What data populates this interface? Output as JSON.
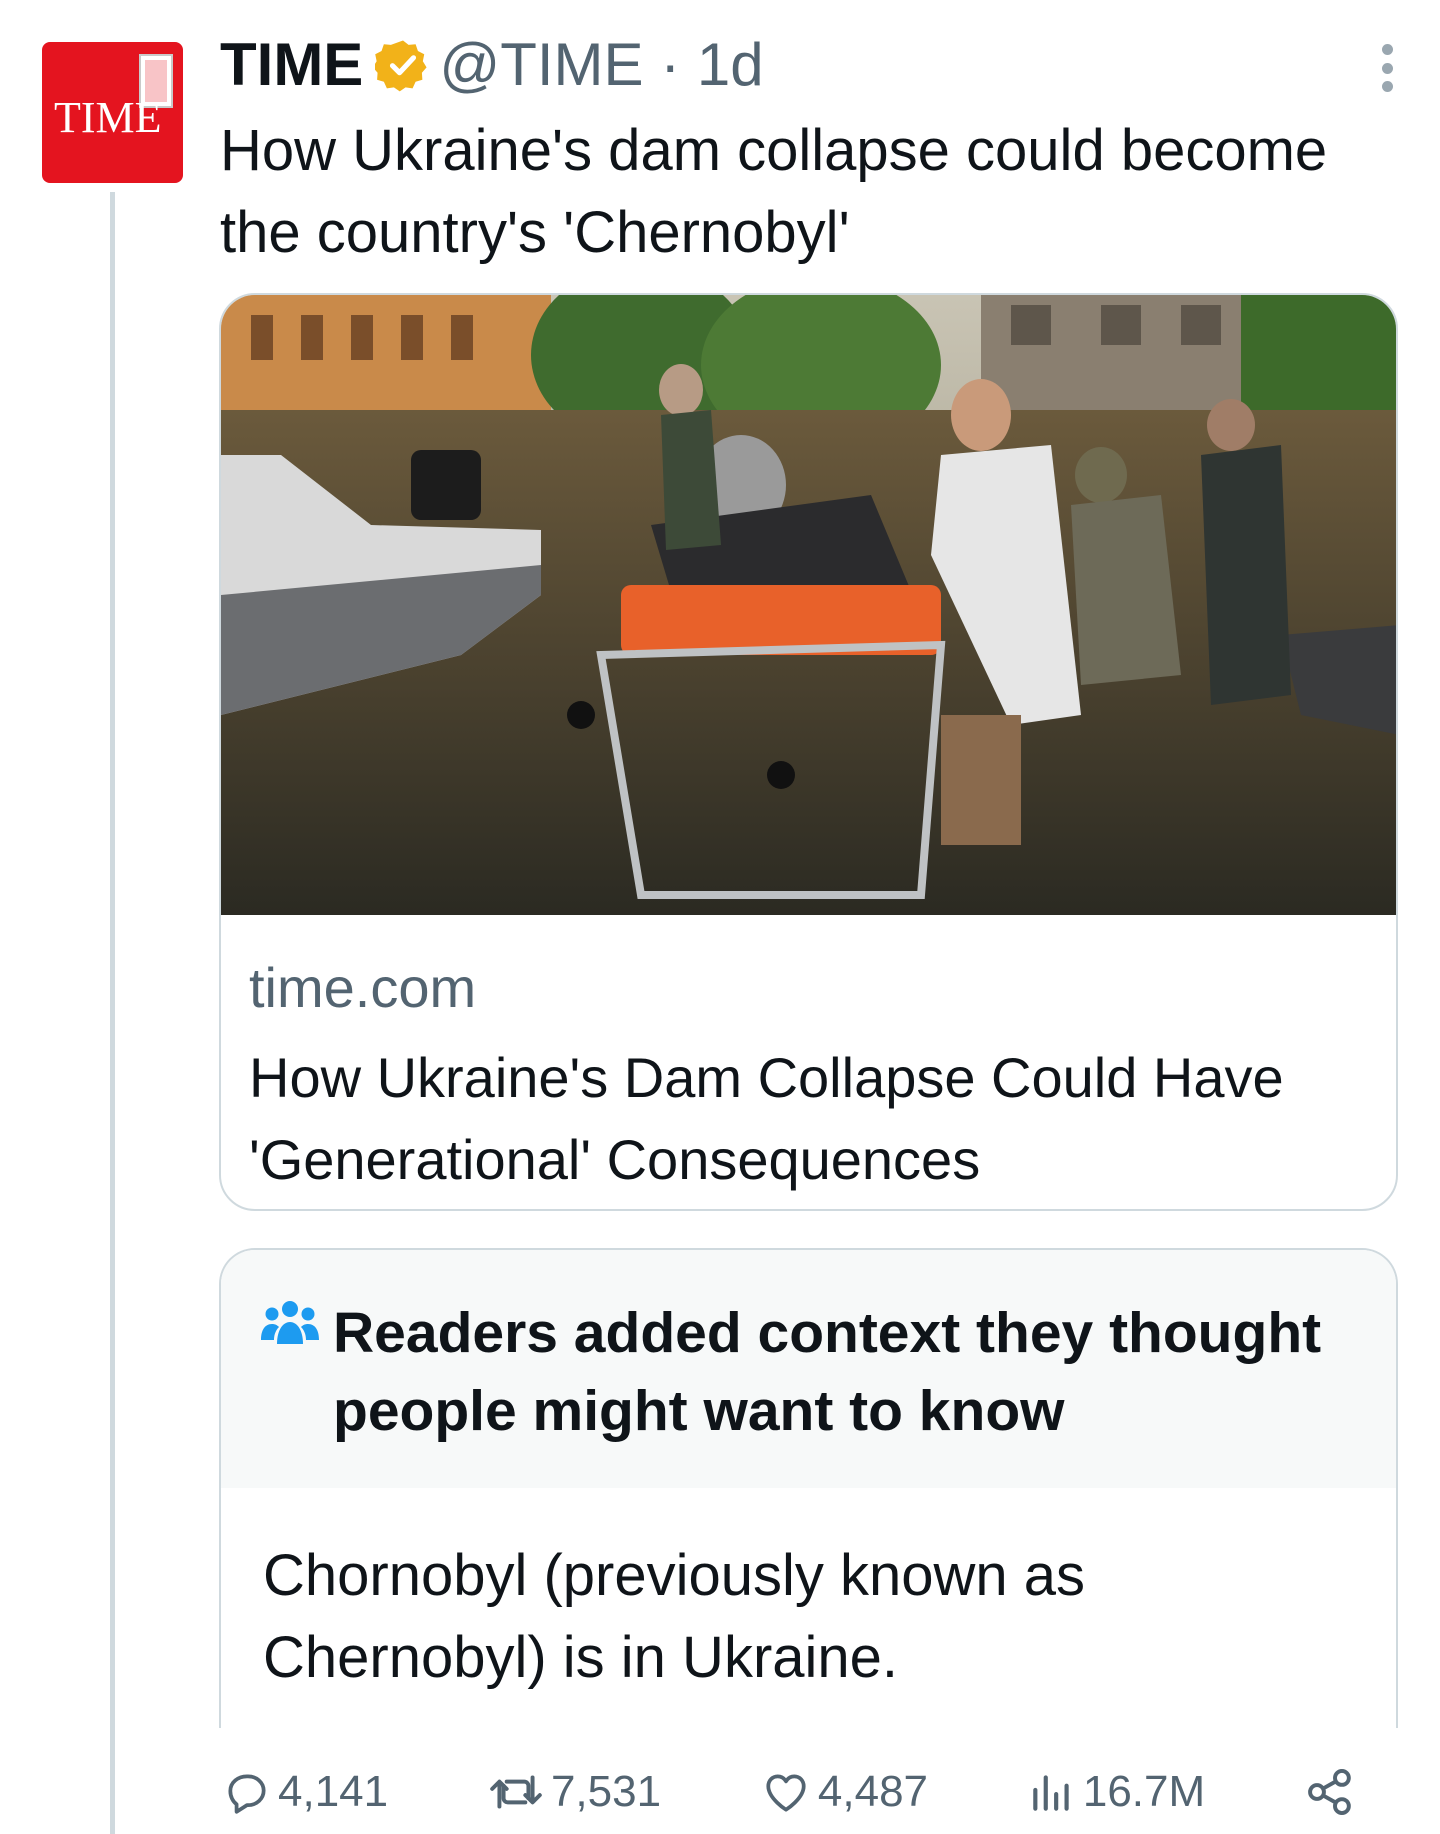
{
  "account": {
    "name": "TIME",
    "handle": "@TIME",
    "separator": " · ",
    "age": "1d",
    "verified_color": "#f2b219",
    "avatar_logo": "TIME"
  },
  "tweet": {
    "text": "How Ukraine's dam collapse could become the country's 'Chernobyl'"
  },
  "card": {
    "domain": "time.com",
    "title": "How Ukraine's Dam Collapse Could Have 'Generational' Consequences",
    "image_description_icon": "flood-rescue-photo"
  },
  "community_note": {
    "icon": "people-icon",
    "icon_color": "#1d9bf0",
    "title": "Readers added context they thought people might want to know",
    "body": "Chornobyl (previously known as Chernobyl) is in Ukraine."
  },
  "actions": {
    "replies": "4,141",
    "reposts": "7,531",
    "likes": "4,487",
    "views": "16.7M"
  }
}
